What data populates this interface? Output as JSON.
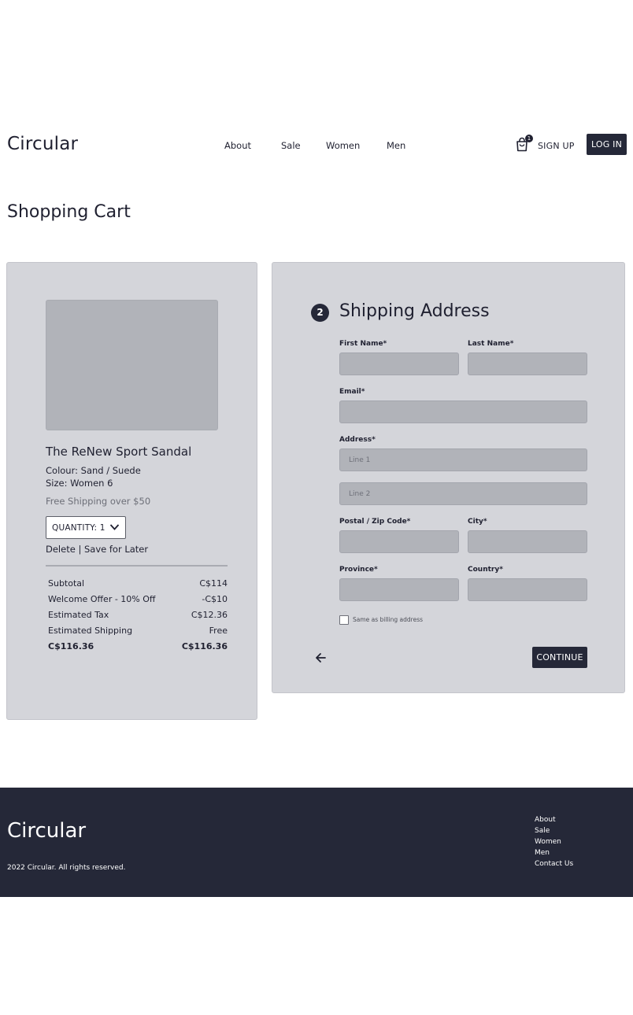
{
  "header": {
    "logo": "Circular",
    "nav": [
      "About",
      "Sale",
      "Women",
      "Men"
    ],
    "cart_count": "1",
    "signup": "SIGN UP",
    "login": "LOG IN"
  },
  "page_title": "Shopping Cart",
  "cart": {
    "product_name": "The ReNew Sport Sandal",
    "colour": "Colour: Sand / Suede",
    "size": "Size: Women 6",
    "shipping_note": "Free Shipping over $50",
    "quantity_label": "QUANTITY: 1",
    "delete_label": "Delete",
    "separator": "|",
    "save_label": "Save for Later",
    "summary": [
      {
        "label": "Subtotal",
        "value": "C$114"
      },
      {
        "label": "Welcome Offer - 10% Off",
        "value": "-C$10"
      },
      {
        "label": "Estimated Tax",
        "value": "C$12.36"
      },
      {
        "label": "Estimated Shipping",
        "value": "Free"
      },
      {
        "label": "C$116.36",
        "value": "C$116.36"
      }
    ]
  },
  "shipping": {
    "step": "2",
    "title": "Shipping Address",
    "first_name_label": "First Name*",
    "last_name_label": "Last Name*",
    "email_label": "Email*",
    "address_label": "Address*",
    "line1_placeholder": "Line 1",
    "line2_placeholder": "Line 2",
    "postal_label": "Postal / Zip Code*",
    "city_label": "City*",
    "province_label": "Province*",
    "country_label": "Country*",
    "same_billing": "Same as billing address",
    "continue": "CONTINUE"
  },
  "footer": {
    "logo": "Circular",
    "copyright": "2022 Circular. All rights reserved.",
    "links": [
      "About",
      "Sale",
      "Women",
      "Men",
      "Contact Us"
    ]
  },
  "colors": {
    "panel": "#d4d5da",
    "field": "#b1b3b9",
    "dark": "#252838"
  }
}
